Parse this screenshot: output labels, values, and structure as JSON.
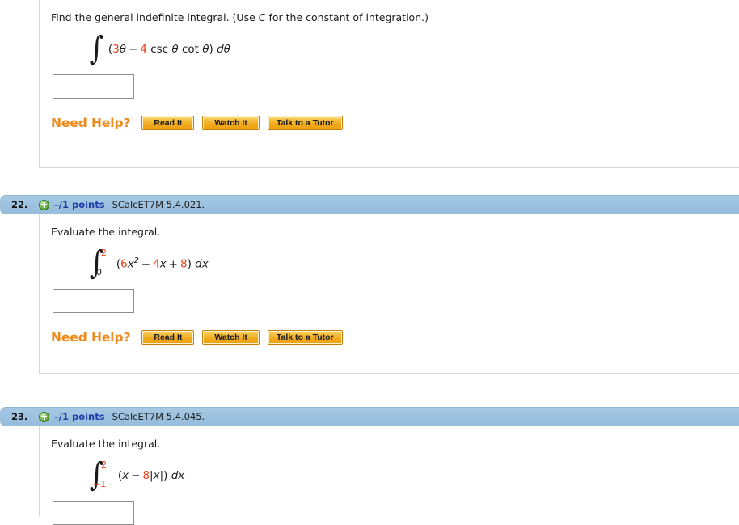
{
  "questions": [
    {
      "number": "",
      "points": "",
      "code": "",
      "show_header": false,
      "prompt_pre": "Find the general indefinite integral. (Use ",
      "prompt_var": "C",
      "prompt_post": " for the constant of integration.)",
      "integral": {
        "symbol": "∫",
        "upper": "",
        "lower": "",
        "open_paren": "(",
        "coef1": "3",
        "var1": "θ",
        "op1": "−",
        "coef2": "4",
        "func1": "csc",
        "var2": "θ",
        "func2": "cot",
        "var3": "θ",
        "close_paren": ")",
        "differential": "dθ"
      },
      "answer_value": "",
      "answer_placeholder": "",
      "need_help_label": "Need Help?",
      "buttons": [
        "Read It",
        "Watch It",
        "Talk to a Tutor"
      ],
      "closed": true
    },
    {
      "number": "22.",
      "points": "–/1 points",
      "code": "SCalcET7M 5.4.021.",
      "show_header": true,
      "prompt_pre": "Evaluate the integral.",
      "prompt_var": "",
      "prompt_post": "",
      "integral": {
        "symbol": "∫",
        "upper": "2",
        "lower": "0",
        "open_paren": "(",
        "coef1": "6",
        "var1": "x",
        "exponent": "2",
        "op1": "−",
        "coef2": "4",
        "var2": "x",
        "op2": "+",
        "coef3": "8",
        "close_paren": ")",
        "differential": "dx"
      },
      "answer_value": "",
      "answer_placeholder": "",
      "need_help_label": "Need Help?",
      "buttons": [
        "Read It",
        "Watch It",
        "Talk to a Tutor"
      ],
      "closed": true
    },
    {
      "number": "23.",
      "points": "–/1 points",
      "code": "SCalcET7M 5.4.045.",
      "show_header": true,
      "prompt_pre": "Evaluate the integral.",
      "prompt_var": "",
      "prompt_post": "",
      "integral": {
        "symbol": "∫",
        "upper": "2",
        "lower": "−1",
        "open_paren": "(",
        "var1": "x",
        "op1": "−",
        "coef2": "8",
        "abs_open": "|",
        "var2": "x",
        "abs_close": "|",
        "close_paren": ")",
        "differential": "dx"
      },
      "answer_value": "",
      "answer_placeholder": "",
      "closed": false
    }
  ],
  "colors": {
    "header_bar": "#9dc2e0",
    "points_text": "#1c3fa8",
    "number_red": "#e8411c",
    "need_help_orange": "#ee8b1e",
    "button_orange": "#f0a81b",
    "panel_border": "#d8d8d8"
  }
}
